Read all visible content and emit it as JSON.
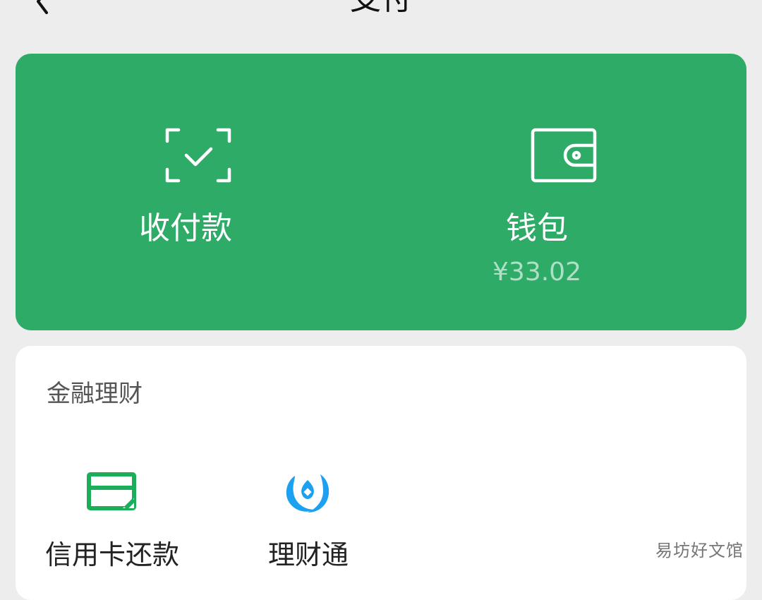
{
  "header": {
    "back_icon": "back-arrow-icon",
    "title": "支付"
  },
  "top_actions": [
    {
      "label": "收付款",
      "icon": "scan-check-icon",
      "sub": ""
    },
    {
      "label": "钱包",
      "icon": "wallet-icon",
      "sub": "¥33.02"
    }
  ],
  "finance": {
    "title": "金融理财",
    "items": [
      {
        "label": "信用卡还款",
        "icon": "credit-card-icon"
      },
      {
        "label": "理财通",
        "icon": "licaitong-icon"
      }
    ]
  },
  "watermark": "易坊好文馆",
  "colors": {
    "brand_green": "#2eab67",
    "background": "#ededed",
    "licaitong_blue": "#1ba0f2"
  }
}
